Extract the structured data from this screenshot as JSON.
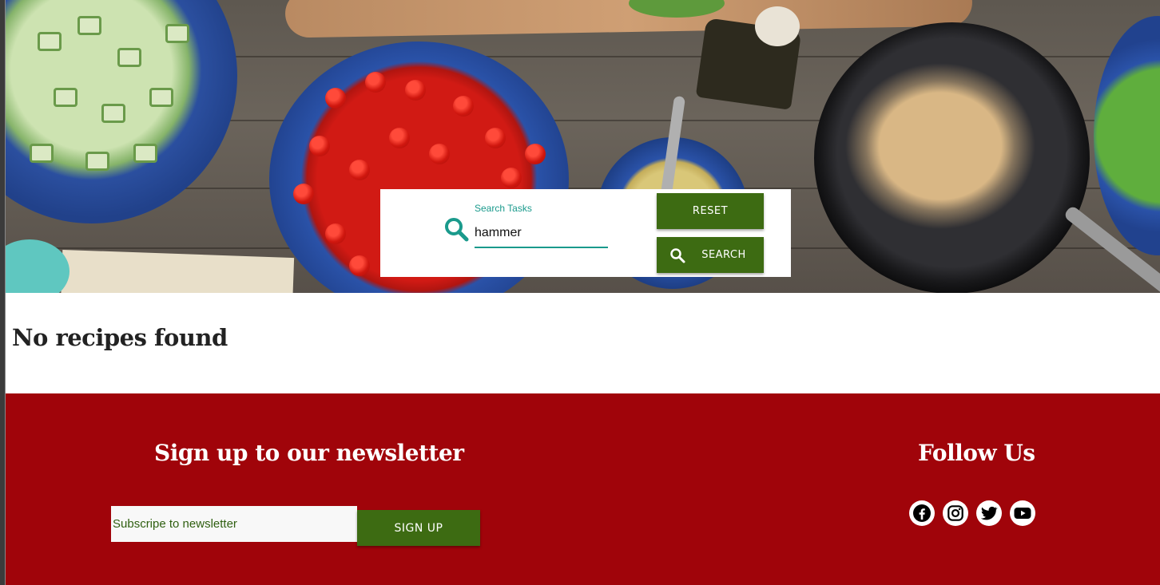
{
  "search": {
    "label": "Search Tasks",
    "value": "hammer",
    "reset_label": "RESET",
    "search_label": "SEARCH"
  },
  "results": {
    "message": "No recipes found"
  },
  "footer": {
    "newsletter_title": "Sign up to our newsletter",
    "newsletter_placeholder": "Subscripe to newsletter",
    "signup_label": "SIGN UP",
    "follow_title": "Follow Us",
    "social": [
      "facebook-icon",
      "instagram-icon",
      "twitter-icon",
      "youtube-icon"
    ]
  },
  "colors": {
    "accent_teal": "#1a9a8c",
    "button_green": "#3d6b12",
    "footer_red": "#a0040a"
  }
}
